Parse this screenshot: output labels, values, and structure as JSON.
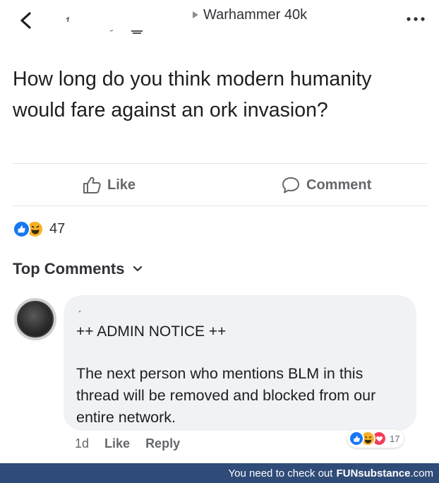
{
  "header": {
    "group_name": "Warhammer 40k",
    "icons": {
      "back": "chevron-left-icon",
      "breadcrumb": "triangle-right-icon",
      "more": "more-horizontal-icon"
    }
  },
  "post": {
    "text": "How long do you think modern humanity would fare against an ork invasion?"
  },
  "actions": {
    "like_label": "Like",
    "comment_label": "Comment"
  },
  "reactions": {
    "icons": [
      "like-reaction-icon",
      "haha-reaction-icon"
    ],
    "count": "47"
  },
  "comments_section": {
    "sort_label": "Top Comments"
  },
  "comment": {
    "notice": "++ ADMIN NOTICE ++",
    "body": "The next person who mentions BLM in this thread will be removed and blocked from our entire network.",
    "time": "1d",
    "like_label": "Like",
    "reply_label": "Reply",
    "reaction_icons": [
      "like-reaction-icon",
      "haha-reaction-icon",
      "love-reaction-icon"
    ],
    "reaction_count": "17"
  },
  "footer": {
    "text": "You need to check out",
    "brand_bold": "FUNsubstance",
    "brand_suffix": ".com"
  },
  "colors": {
    "like_blue": "#1877f2",
    "love_red": "#f33e58",
    "haha_yellow": "#f7b125",
    "footer_bg": "#2f4b78",
    "muted_text": "#65676b"
  }
}
